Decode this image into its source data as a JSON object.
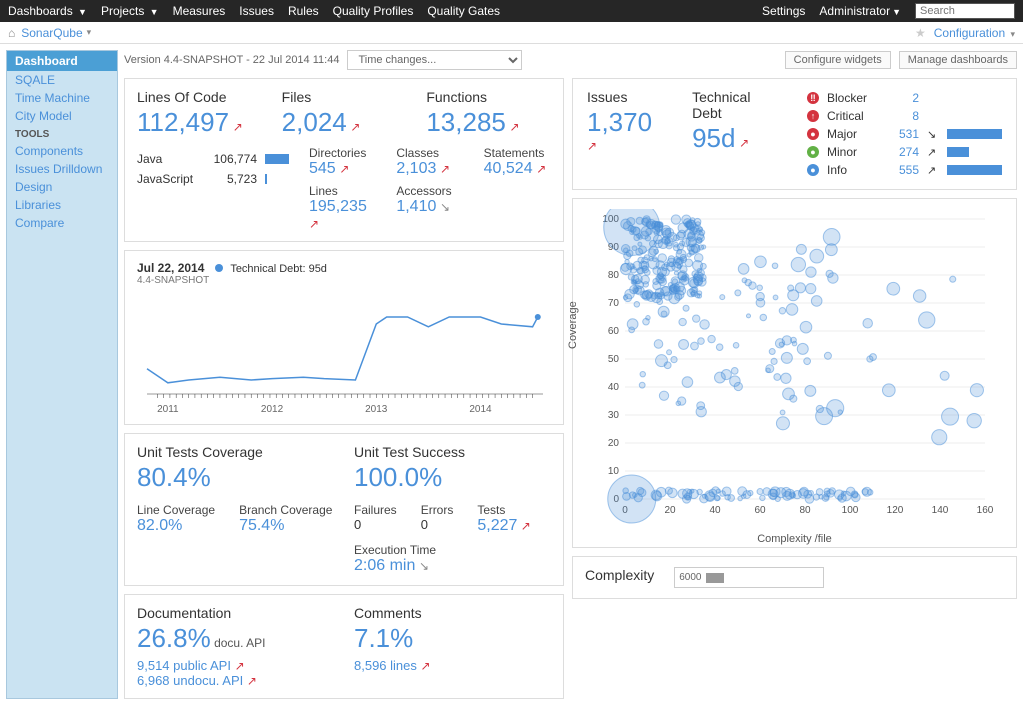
{
  "topbar": {
    "items": [
      "Dashboards",
      "Projects",
      "Measures",
      "Issues",
      "Rules",
      "Quality Profiles",
      "Quality Gates"
    ],
    "right": {
      "settings": "Settings",
      "admin": "Administrator",
      "search_placeholder": "Search"
    }
  },
  "subbar": {
    "breadcrumb": "SonarQube",
    "config": "Configuration"
  },
  "sidebar": {
    "items": [
      {
        "label": "Dashboard",
        "active": true
      },
      {
        "label": "SQALE"
      },
      {
        "label": "Time Machine"
      },
      {
        "label": "City Model"
      }
    ],
    "tools_label": "TOOLS",
    "tools": [
      {
        "label": "Components"
      },
      {
        "label": "Issues Drilldown"
      },
      {
        "label": "Design"
      },
      {
        "label": "Libraries"
      },
      {
        "label": "Compare"
      }
    ]
  },
  "header": {
    "version_text": "Version 4.4-SNAPSHOT - 22 Jul 2014 11:44",
    "time_select": "Time changes...",
    "buttons": {
      "configure": "Configure widgets",
      "manage": "Manage dashboards"
    }
  },
  "loc": {
    "title": "Lines Of Code",
    "value": "112,497",
    "files_title": "Files",
    "files": "2,024",
    "functions_title": "Functions",
    "functions": "13,285",
    "langs": [
      {
        "name": "Java",
        "count": "106,774"
      },
      {
        "name": "JavaScript",
        "count": "5,723"
      }
    ],
    "directories_label": "Directories",
    "directories": "545",
    "lines_label": "Lines",
    "lines": "195,235",
    "classes_label": "Classes",
    "classes": "2,103",
    "accessors_label": "Accessors",
    "accessors": "1,410",
    "statements_label": "Statements",
    "statements": "40,524"
  },
  "debt_chart": {
    "date": "Jul 22, 2014",
    "snapshot": "4.4-SNAPSHOT",
    "legend": "Technical Debt: 95d"
  },
  "chart_data": {
    "type": "line",
    "title": "Technical Debt over time",
    "xlabel": "",
    "ylabel": "",
    "x_ticks": [
      "2011",
      "2012",
      "2013",
      "2014"
    ],
    "series": [
      {
        "name": "Technical Debt",
        "x": [
          2010.8,
          2011.0,
          2011.2,
          2011.5,
          2011.8,
          2012.0,
          2012.3,
          2012.5,
          2012.8,
          2013.0,
          2013.1,
          2013.3,
          2013.5,
          2013.7,
          2014.0,
          2014.2,
          2014.5,
          2014.55
        ],
        "y": [
          58,
          48,
          50,
          52,
          50,
          51,
          52,
          51,
          50,
          90,
          95,
          95,
          88,
          95,
          95,
          90,
          88,
          95
        ]
      }
    ],
    "ylim": [
      40,
      110
    ]
  },
  "coverage": {
    "title": "Unit Tests Coverage",
    "value": "80.4%",
    "line_label": "Line Coverage",
    "line": "82.0%",
    "branch_label": "Branch Coverage",
    "branch": "75.4%",
    "success_title": "Unit Test Success",
    "success": "100.0%",
    "failures_label": "Failures",
    "failures": "0",
    "errors_label": "Errors",
    "errors": "0",
    "tests_label": "Tests",
    "tests": "5,227",
    "exec_label": "Execution Time",
    "exec": "2:06 min"
  },
  "docs": {
    "title": "Documentation",
    "value": "26.8%",
    "suffix": " docu. API",
    "public": "9,514 public API",
    "undocu": "6,968 undocu. API",
    "comments_title": "Comments",
    "comments": "7.1%",
    "comment_lines": "8,596 lines"
  },
  "issues": {
    "title": "Issues",
    "value": "1,370",
    "debt_title": "Technical Debt",
    "debt": "95d",
    "severities": [
      {
        "key": "blocker",
        "glyph": "‼",
        "label": "Blocker",
        "count": "2",
        "arrow": "",
        "bar": 0
      },
      {
        "key": "critical",
        "glyph": "↑",
        "label": "Critical",
        "count": "8",
        "arrow": "",
        "bar": 0
      },
      {
        "key": "major",
        "glyph": "●",
        "label": "Major",
        "count": "531",
        "arrow": "↘",
        "arrow_cls": "green",
        "bar": 55
      },
      {
        "key": "minor",
        "glyph": "●",
        "label": "Minor",
        "count": "274",
        "arrow": "↗",
        "arrow_cls": "red",
        "bar": 22
      },
      {
        "key": "info",
        "glyph": "●",
        "label": "Info",
        "count": "555",
        "arrow": "↗",
        "arrow_cls": "red",
        "bar": 55
      }
    ]
  },
  "scatter": {
    "ylabel": "Coverage",
    "xlabel": "Complexity /file",
    "y_ticks": [
      "0",
      "10",
      "20",
      "30",
      "40",
      "50",
      "60",
      "70",
      "80",
      "90",
      "100"
    ],
    "x_ticks": [
      "0",
      "20",
      "40",
      "60",
      "80",
      "100",
      "120",
      "140",
      "160"
    ]
  },
  "complexity": {
    "title": "Complexity",
    "mini_labels": [
      "6000"
    ]
  }
}
